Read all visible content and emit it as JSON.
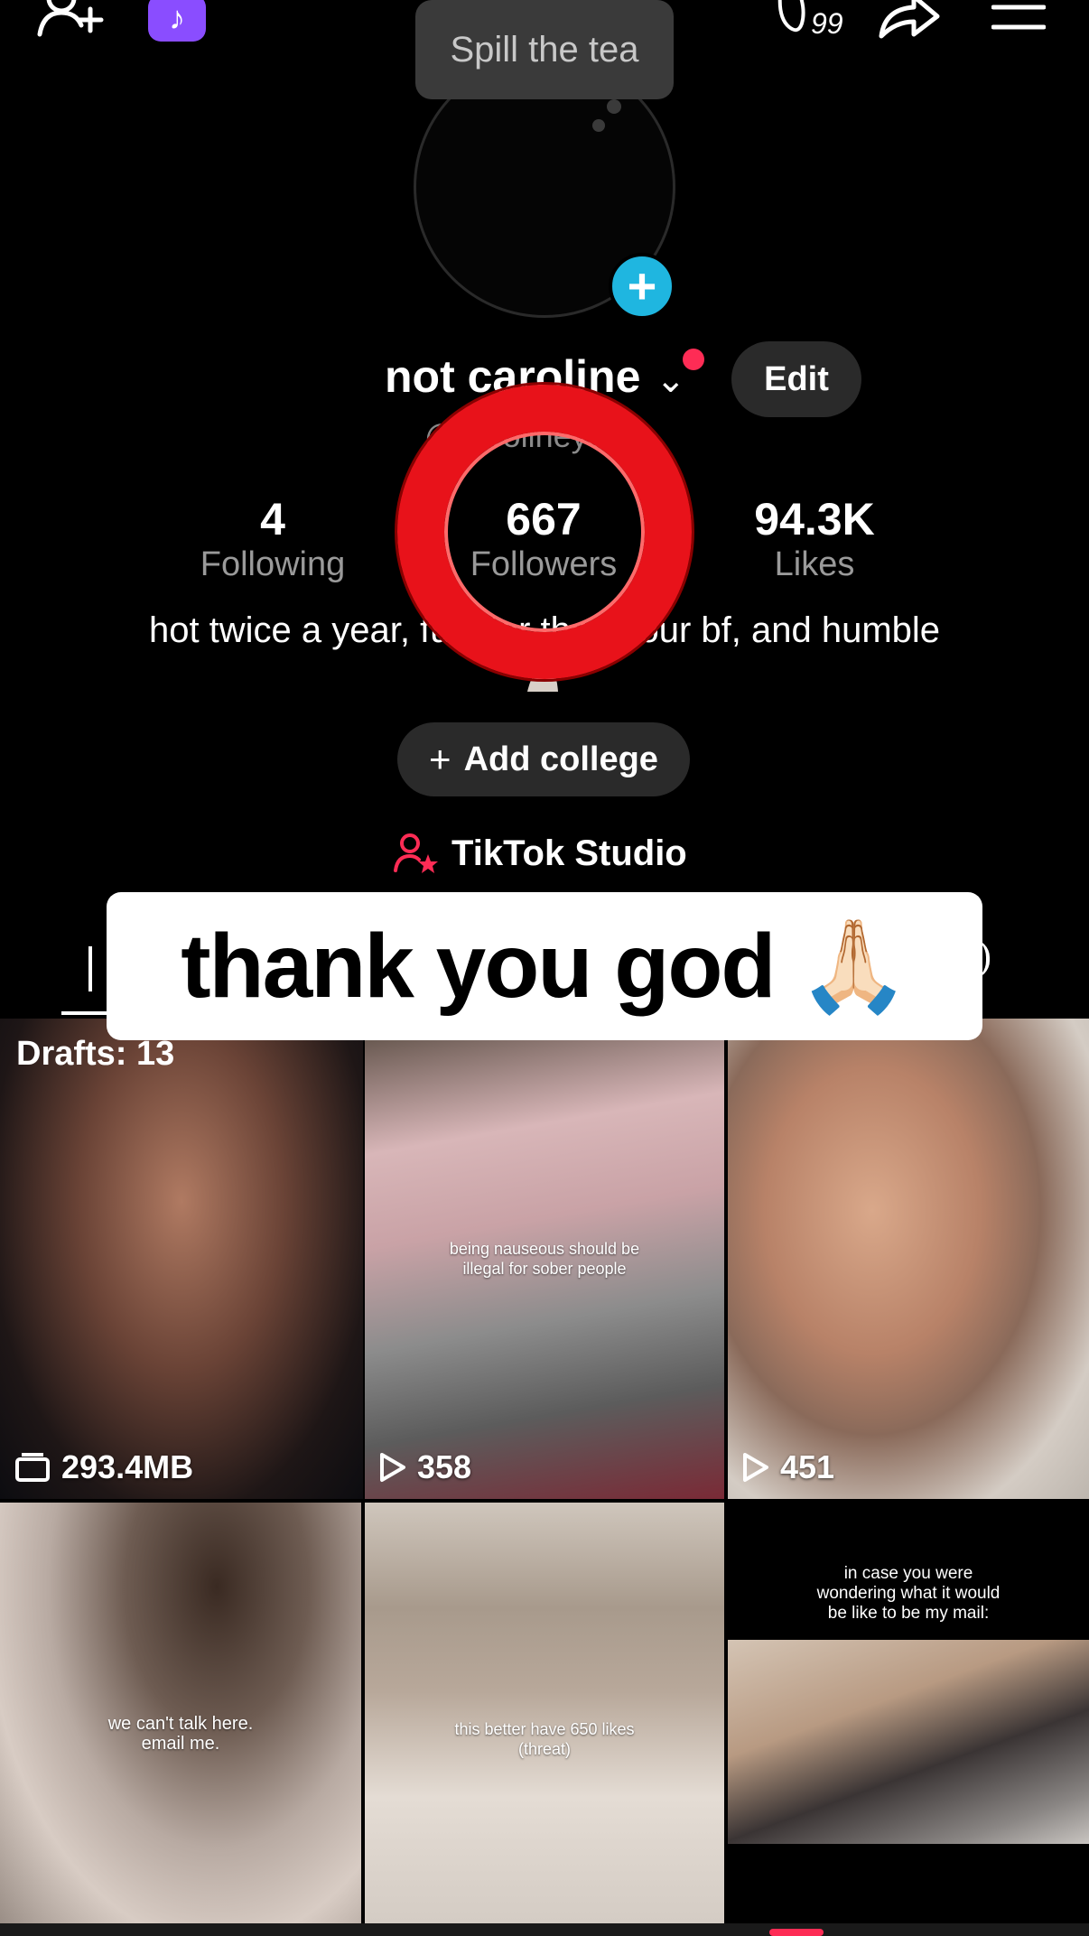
{
  "tooltip": {
    "text": "Spill the tea"
  },
  "topbar": {
    "notification_count": "99"
  },
  "profile": {
    "display_name": "not caroline",
    "handle": "@carolineyates",
    "edit_label": "Edit",
    "stats": [
      {
        "value": "4",
        "label": "Following"
      },
      {
        "value": "667",
        "label": "Followers"
      },
      {
        "value": "94.3K",
        "label": "Likes"
      }
    ],
    "bio": "hot twice a year, funnier than your bf, and humble",
    "add_college_label": "Add college",
    "studio_label": "TikTok Studio"
  },
  "caption_overlay": {
    "text": "thank you god 🙏🏻"
  },
  "grid": {
    "drafts_label": "Drafts: 13",
    "drafts_size": "293.4MB",
    "videos": [
      {
        "views": "358",
        "overlay": "being nauseous should be illegal for sober people"
      },
      {
        "views": "451",
        "overlay": ""
      },
      {
        "views": "",
        "overlay": "we can't talk here. email me."
      },
      {
        "views": "",
        "overlay": "this better have 650 likes (threat)"
      },
      {
        "views": "",
        "overlay": "in case you were wondering what it would be like to be my mail:"
      }
    ]
  },
  "colors": {
    "accent": "#fe2c55",
    "plus_badge": "#1fb6e0",
    "ring": "#e8121a",
    "tiktok_badge": "#8a4dff"
  }
}
